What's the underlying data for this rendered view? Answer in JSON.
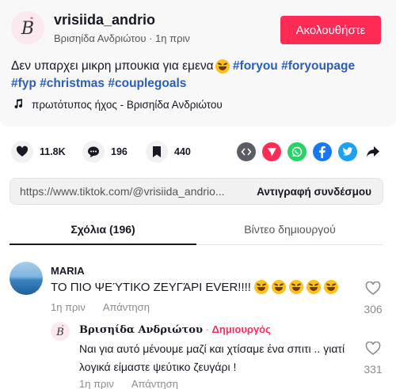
{
  "post": {
    "username": "vrisiida_andrio",
    "display_name": "Βρισηίδα Ανδριώτου",
    "time_ago": "1η πριν",
    "follow_label": "Ακολουθήστε",
    "description_text": "Δεν υπαρχει μικρη μπουκια για εμενα",
    "hashtags": [
      "#foryou",
      "#foryoupage",
      "#fyp",
      "#christmas",
      "#couplegoals"
    ],
    "music_label": "πρωτότυπος ήχος - Βρισηίδα Ανδριώτου"
  },
  "actions": {
    "likes": "11.8K",
    "comments": "196",
    "saves": "440",
    "share_targets": [
      "embed-icon",
      "send-icon",
      "whatsapp-icon",
      "facebook-icon",
      "twitter-icon",
      "share-arrow-icon"
    ]
  },
  "link": {
    "url": "https://www.tiktok.com/@vrisiida_andrio...",
    "copy_label": "Αντιγραφή συνδέσμου"
  },
  "tabs": {
    "comments_label": "Σχόλια (196)",
    "creator_videos_label": "Βίντεο δημιουργού"
  },
  "comment": {
    "user": "MARIA",
    "text": "ΤΟ ΠΙΟ ΨΕΎΤΙΚΟ ΖΕΥΓΆΡΙ EVER!!!!",
    "time_ago": "1η πριν",
    "reply_label": "Απάντηση",
    "likes": "306"
  },
  "reply": {
    "user": "Βρισηίδα Ανδριώτου",
    "separator": " · ",
    "creator_badge": "Δημιουργός",
    "text": "Ναι για αυτό μένουμε μαζί και χτίσαμε ένα σπιτι .. γιατί λογικά είμαστε ψεύτικο ζευγάρι !",
    "time_ago": "1η πριν",
    "reply_label": "Απάντηση",
    "likes": "331"
  },
  "colors": {
    "accent": "#fe2c55",
    "hashtag": "#2b5db9",
    "whatsapp": "#25d366",
    "facebook": "#1877f2",
    "twitter": "#1da1f2"
  }
}
